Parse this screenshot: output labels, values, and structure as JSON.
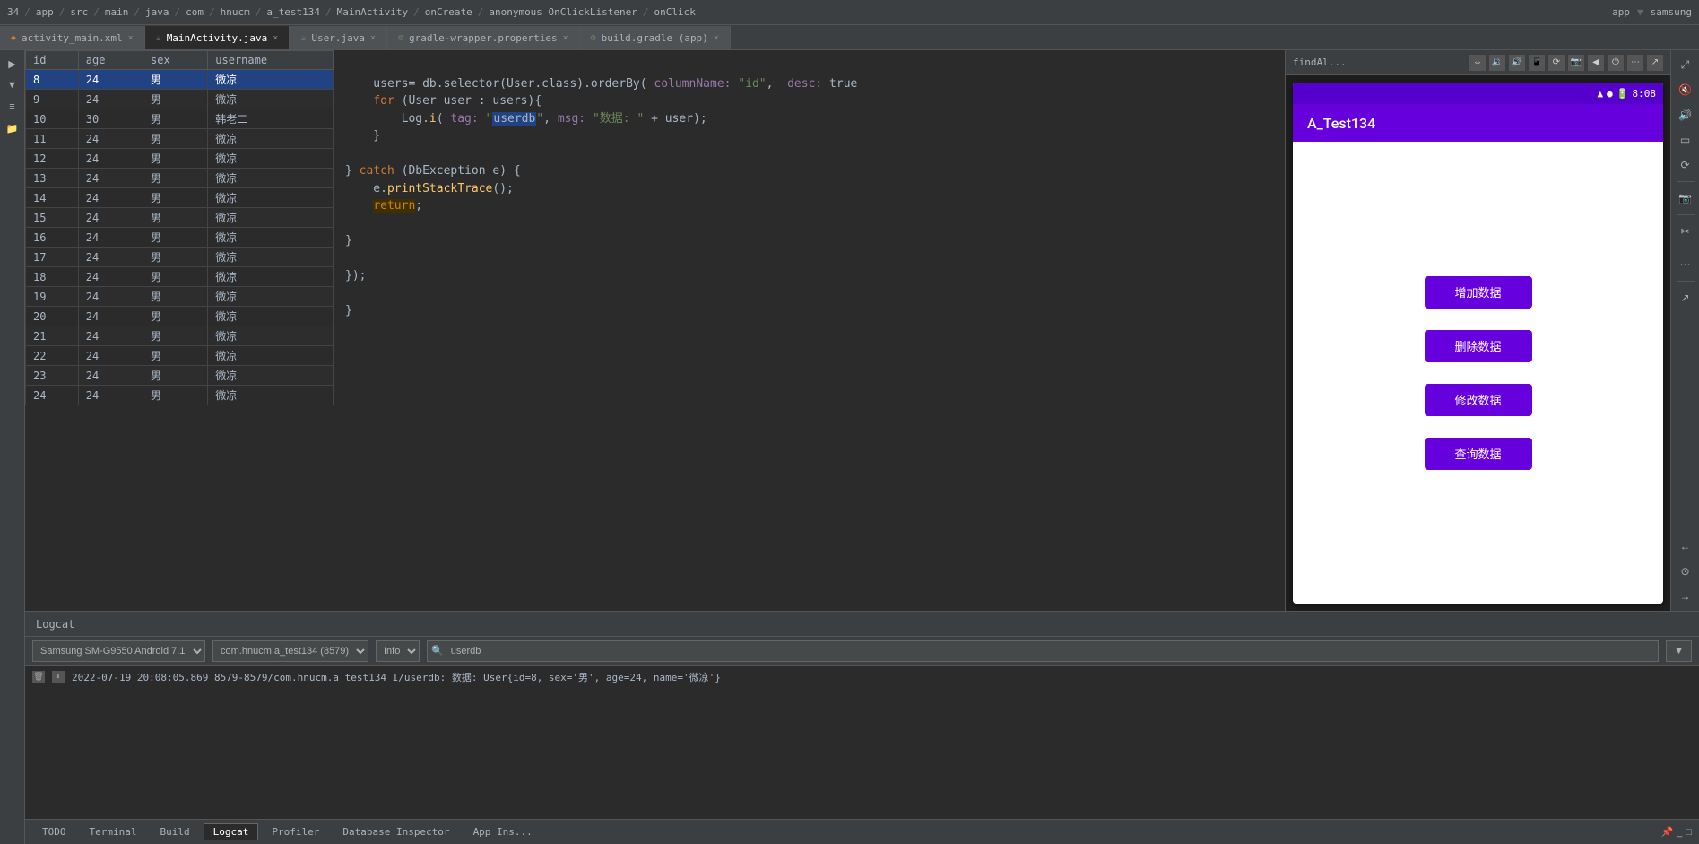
{
  "topbar": {
    "items": [
      "34",
      "app",
      "src",
      "main",
      "java",
      "com",
      "hnucm",
      "a_test134",
      "MainActivity",
      "onCreate",
      "anonymous OnClickListener",
      "onClick",
      "app",
      "samsung"
    ]
  },
  "tabs": [
    {
      "id": "tab1",
      "label": "activity_main.xml",
      "type": "xml",
      "active": false
    },
    {
      "id": "tab2",
      "label": "MainActivity.java",
      "type": "java",
      "active": true
    },
    {
      "id": "tab3",
      "label": "User.java",
      "type": "java",
      "active": false
    },
    {
      "id": "tab4",
      "label": "gradle-wrapper.properties",
      "type": "gradle",
      "active": false
    },
    {
      "id": "tab5",
      "label": "build.gradle (app)",
      "type": "gradle",
      "active": false
    }
  ],
  "database": {
    "columns": [
      "id",
      "age",
      "sex",
      "username"
    ],
    "rows": [
      {
        "id": "8",
        "age": "24",
        "sex": "男",
        "username": "微凉",
        "selected": true
      },
      {
        "id": "9",
        "age": "24",
        "sex": "男",
        "username": "微凉"
      },
      {
        "id": "10",
        "age": "30",
        "sex": "男",
        "username": "韩老二"
      },
      {
        "id": "11",
        "age": "24",
        "sex": "男",
        "username": "微凉"
      },
      {
        "id": "12",
        "age": "24",
        "sex": "男",
        "username": "微凉"
      },
      {
        "id": "13",
        "age": "24",
        "sex": "男",
        "username": "微凉"
      },
      {
        "id": "14",
        "age": "24",
        "sex": "男",
        "username": "微凉"
      },
      {
        "id": "15",
        "age": "24",
        "sex": "男",
        "username": "微凉"
      },
      {
        "id": "16",
        "age": "24",
        "sex": "男",
        "username": "微凉"
      },
      {
        "id": "17",
        "age": "24",
        "sex": "男",
        "username": "微凉"
      },
      {
        "id": "18",
        "age": "24",
        "sex": "男",
        "username": "微凉"
      },
      {
        "id": "19",
        "age": "24",
        "sex": "男",
        "username": "微凉"
      },
      {
        "id": "20",
        "age": "24",
        "sex": "男",
        "username": "微凉"
      },
      {
        "id": "21",
        "age": "24",
        "sex": "男",
        "username": "微凉"
      },
      {
        "id": "22",
        "age": "24",
        "sex": "男",
        "username": "微凉"
      },
      {
        "id": "23",
        "age": "24",
        "sex": "男",
        "username": "微凉"
      },
      {
        "id": "24",
        "age": "24",
        "sex": "男",
        "username": "微凉"
      }
    ]
  },
  "code": {
    "lines": [
      "    users= db.selector(User.class).orderBy( columnName: \"id\",  desc: true",
      "    for (User user : users){",
      "        Log.i( tag: \"userdb\", msg: \"数据: \" + user);",
      "    }",
      "",
      "} catch (DbException e) {",
      "    e.printStackTrace();",
      "    return;",
      "",
      "}",
      "",
      "});"
    ]
  },
  "android": {
    "app_title": "A_Test134",
    "status_time": "8:08",
    "buttons": [
      {
        "id": "btn1",
        "label": "增加数据"
      },
      {
        "id": "btn2",
        "label": "删除数据"
      },
      {
        "id": "btn3",
        "label": "修改数据"
      },
      {
        "id": "btn4",
        "label": "查询数据"
      }
    ]
  },
  "logcat": {
    "title": "Logcat",
    "device": "Samsung SM-G9550 Android 7.1",
    "package": "com.hnucm.a_test134 (8579)",
    "level": "Info",
    "search_placeholder": "userdb",
    "log_line": "2022-07-19 20:08:05.869 8579-8579/com.hnucm.a_test134 I/userdb: 数据: User{id=8, sex='男', age=24, name='微凉'}"
  },
  "bottom_tabs": [
    {
      "label": "TODO"
    },
    {
      "label": "Terminal"
    },
    {
      "label": "Build"
    },
    {
      "label": "Logcat",
      "active": true
    },
    {
      "label": "Profiler"
    },
    {
      "label": "Database Inspector"
    },
    {
      "label": "App Ins..."
    }
  ],
  "right_panel_label": "indAl...",
  "find_label": "findAl..."
}
